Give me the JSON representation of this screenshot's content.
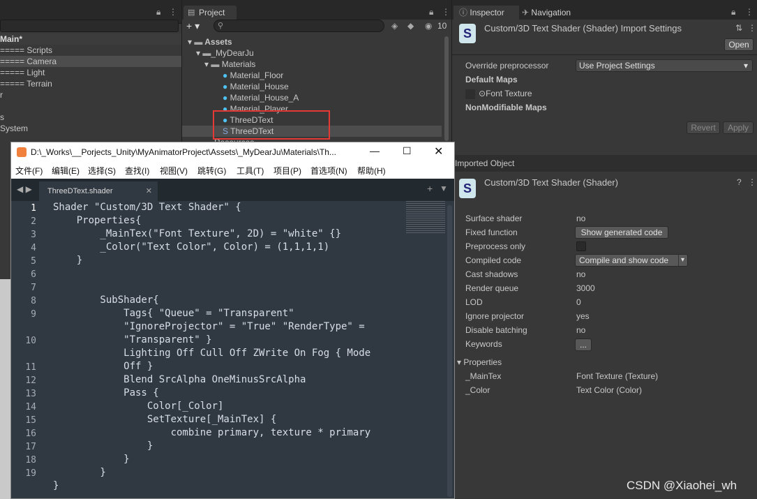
{
  "hierarchy": {
    "scene_name": "Main*",
    "items": [
      "===== Scripts",
      "===== Camera",
      "===== Light",
      "===== Terrain",
      "r",
      "",
      "s",
      "System"
    ]
  },
  "project": {
    "tab_label": "Project",
    "add_label": "+ ▾",
    "hidden_count": "10",
    "tree": {
      "assets": "Assets",
      "mydearju": "_MyDearJu",
      "materials": "Materials",
      "files": [
        "Material_Floor",
        "Material_House",
        "Material_House_A",
        "Material_Player",
        "ThreeDText",
        "ThreeDText"
      ],
      "more": "Resources"
    }
  },
  "inspector": {
    "tab_inspector": "Inspector",
    "tab_navigation": "Navigation",
    "title": "Custom/3D Text Shader (Shader) Import Settings",
    "open_button": "Open",
    "override_label": "Override preprocessor",
    "override_value": "Use Project Settings",
    "default_maps": "Default Maps",
    "font_texture": "Font Texture",
    "nonmodifiable": "NonModifiable Maps",
    "revert": "Revert",
    "apply": "Apply",
    "imported_object": "Imported Object",
    "shader_title": "Custom/3D Text Shader (Shader)",
    "rows": [
      {
        "label": "Surface shader",
        "value": "no"
      },
      {
        "label": "Fixed function",
        "value": "Show generated code"
      },
      {
        "label": "Preprocess only",
        "value": ""
      },
      {
        "label": "Compiled code",
        "value": "Compile and show code"
      },
      {
        "label": "Cast shadows",
        "value": "no"
      },
      {
        "label": "Render queue",
        "value": "3000"
      },
      {
        "label": "LOD",
        "value": "0"
      },
      {
        "label": "Ignore projector",
        "value": "yes"
      },
      {
        "label": "Disable batching",
        "value": "no"
      },
      {
        "label": "Keywords",
        "value": "..."
      }
    ],
    "properties_header": "Properties",
    "properties": [
      {
        "name": "_MainTex",
        "value": "Font Texture (Texture)"
      },
      {
        "name": "_Color",
        "value": "Text Color (Color)"
      }
    ]
  },
  "editor": {
    "title": "D:\\_Works\\__Porjects_Unity\\MyAnimatorProject\\Assets\\_MyDearJu\\Materials\\Th...",
    "menu": [
      "文件(F)",
      "编辑(E)",
      "选择(S)",
      "查找(I)",
      "视图(V)",
      "跳转(G)",
      "工具(T)",
      "项目(P)",
      "首选项(N)",
      "帮助(H)"
    ],
    "file_tab": "ThreeDText.shader",
    "line_numbers": [
      "1",
      "2",
      "3",
      "4",
      "5",
      "6",
      "7",
      "8",
      "9",
      "",
      "10",
      "",
      "11",
      "12",
      "13",
      "14",
      "15",
      "16",
      "17",
      "18",
      "19"
    ],
    "code_lines": [
      "Shader \"Custom/3D Text Shader\" {",
      "    Properties{",
      "        _MainTex(\"Font Texture\", 2D) = \"white\" {}",
      "        _Color(\"Text Color\", Color) = (1,1,1,1)",
      "    }",
      "",
      "",
      "        SubShader{",
      "            Tags{ \"Queue\" = \"Transparent\"",
      "            \"IgnoreProjector\" = \"True\" \"RenderType\" =",
      "            \"Transparent\" }",
      "            Lighting Off Cull Off ZWrite On Fog { Mode",
      "            Off }",
      "            Blend SrcAlpha OneMinusSrcAlpha",
      "            Pass {",
      "                Color[_Color]",
      "                SetTexture[_MainTex] {",
      "                    combine primary, texture * primary",
      "                }",
      "            }",
      "        }",
      "}"
    ]
  },
  "watermark": "CSDN @Xiaohei_wh"
}
